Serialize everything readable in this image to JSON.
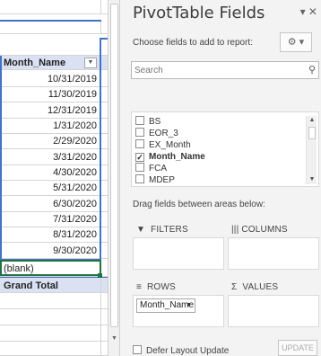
{
  "sheet": {
    "header": "Month_Name",
    "filter_icon": "dropdown-filter-icon",
    "dates": [
      "10/31/2019",
      "11/30/2019",
      "12/31/2019",
      "1/31/2020",
      "2/29/2020",
      "3/31/2020",
      "4/30/2020",
      "5/31/2020",
      "6/30/2020",
      "7/31/2020",
      "8/31/2020",
      "9/30/2020"
    ],
    "blank": "(blank)",
    "grand_total": "Grand Total",
    "header_color": "#d9e1f2",
    "selection_color": "#4472c4",
    "active_color": "#217346"
  },
  "pane": {
    "title": "PivotTable Fields",
    "controls": "▾ ✕",
    "choose_label": "Choose fields to add to report:",
    "gear_label": "⚙ ▾",
    "search_placeholder": "Search",
    "fields": [
      {
        "label": "BS",
        "checked": false
      },
      {
        "label": "EOR_3",
        "checked": false
      },
      {
        "label": "EX_Month",
        "checked": false
      },
      {
        "label": "Month_Name",
        "checked": true
      },
      {
        "label": "FCA",
        "checked": false
      },
      {
        "label": "MDEP",
        "checked": false
      }
    ],
    "drag_label": "Drag fields between areas below:",
    "areas": {
      "filters": "FILTERS",
      "columns": "COLUMNS",
      "rows": "ROWS",
      "values": "VALUES"
    },
    "rows_chip": "Month_Name",
    "defer_label": "Defer Layout Update",
    "update_label": "UPDATE"
  }
}
